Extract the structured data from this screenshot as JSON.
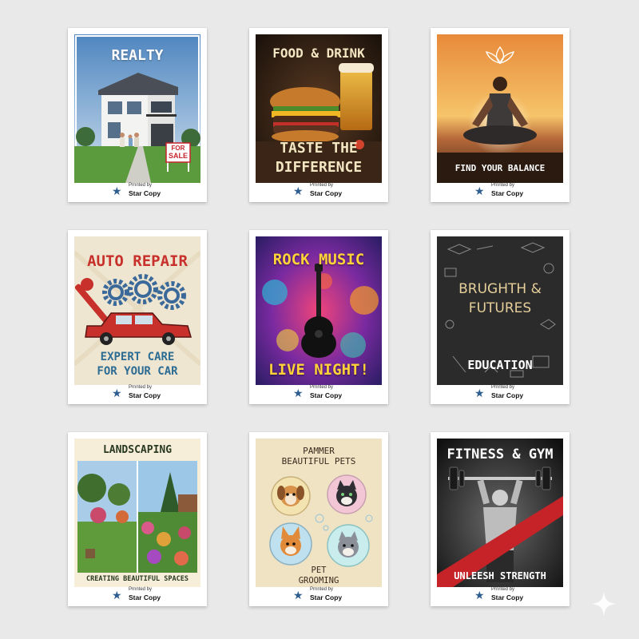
{
  "credit": {
    "small": "Prnnted by",
    "brand": "Star Copy"
  },
  "cards": {
    "realty": {
      "title": "REALTY",
      "sign_top": "FOR",
      "sign_bottom": "SALE"
    },
    "food": {
      "title": "FOOD & DRINK",
      "line1": "TASTE THE",
      "line2": "DIFFERENCE"
    },
    "yoga": {
      "tagline": "FIND YOUR BALANCE"
    },
    "auto": {
      "title": "AUTO REPAIR",
      "line1": "EXPERT CARE",
      "line2": "FOR YOUR CAR"
    },
    "rock": {
      "title": "ROCK MUSIC",
      "tagline": "LIVE NIGHT!"
    },
    "education": {
      "line1": "BRUGHTH &",
      "line2": "FUTURES",
      "tagline": "EDUCATION"
    },
    "landscaping": {
      "title": "LANDSCAPING",
      "tagline": "CREATING BEAUTIFUL SPACES"
    },
    "pets": {
      "line1": "PAMMER",
      "line2": "BEAUTIFUL PETS",
      "line3": "PET",
      "line4": "GROOMING"
    },
    "fitness": {
      "title": "FITNESS & GYM",
      "tagline": "UNLEESH STRENGTH"
    }
  },
  "icons": [
    "star-icon",
    "sparkle-icon",
    "lotus-icon",
    "guitar-icon",
    "gear-icon",
    "wrench-icon",
    "barbell-icon",
    "car-icon"
  ]
}
